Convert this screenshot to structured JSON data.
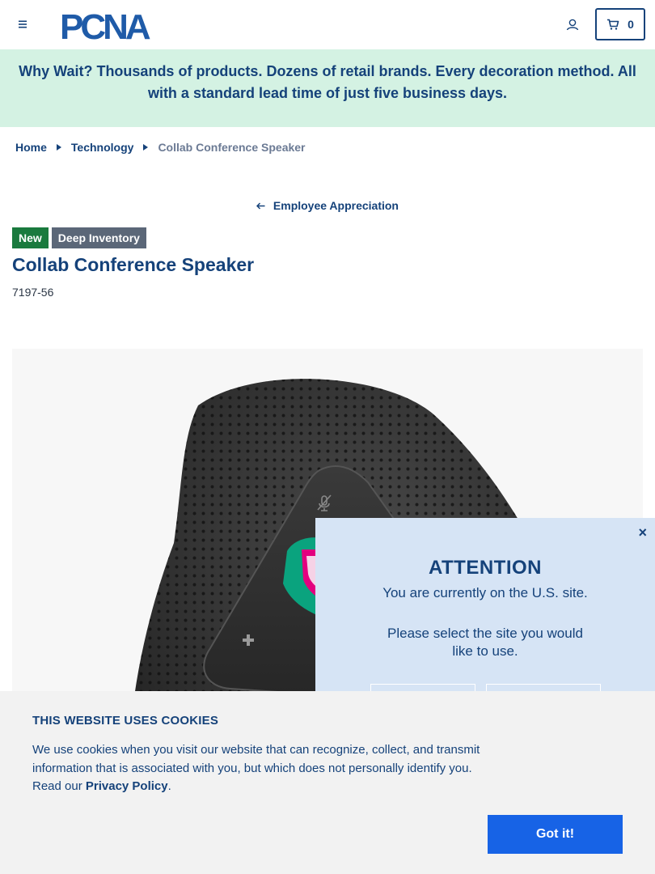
{
  "header": {
    "logo_text": "PCNA",
    "cart_count": "0"
  },
  "banner": {
    "text": "Why Wait? Thousands of products. Dozens of retail brands. Every decoration method. All with a standard lead time of just five business days."
  },
  "breadcrumb": {
    "items": [
      "Home",
      "Technology"
    ],
    "current": "Collab Conference Speaker"
  },
  "back_link": {
    "label": "Employee Appreciation"
  },
  "product": {
    "badges": [
      "New",
      "Deep Inventory"
    ],
    "title": "Collab Conference Speaker",
    "sku": "7197-56"
  },
  "region_popup": {
    "close": "×",
    "title": "ATTENTION",
    "line1": "You are currently on the U.S. site.",
    "line2": "Please select the site you would like to use."
  },
  "cookie_banner": {
    "title": "THIS WEBSITE USES COOKIES",
    "text_before": "We use cookies when you visit our website that can recognize, collect, and transmit information that is associated with you, but which does not personally identify you. Read our ",
    "link": "Privacy Policy",
    "text_after": ".",
    "button": "Got it!"
  },
  "colors": {
    "brand_navy": "#15427a",
    "banner_bg": "#d4f2e3",
    "badge_new": "#1a7a3e",
    "badge_deep": "#5b6778",
    "popup_bg": "#d6e4f5",
    "cookie_button": "#1763e6"
  },
  "icons": {
    "menu": "hamburger-icon",
    "account": "user-icon",
    "cart": "cart-icon",
    "breadcrumb_separator": "caret-right-icon",
    "back": "arrow-left-icon"
  }
}
